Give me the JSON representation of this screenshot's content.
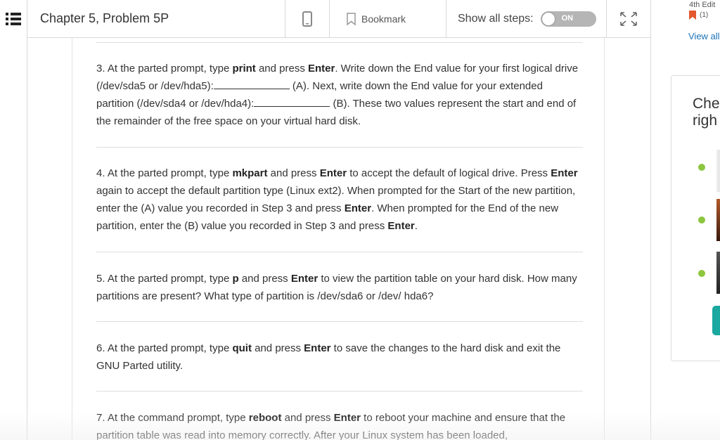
{
  "header": {
    "title": "Chapter 5, Problem 5P",
    "bookmark_label": "Bookmark",
    "show_steps_label": "Show all steps:",
    "toggle_label": "ON",
    "menu_icon": "menu-list-icon",
    "device_icon": "phone-icon",
    "expand_icon": "expand-arrows-icon"
  },
  "steps": [
    {
      "parts": [
        {
          "t": "3. At the parted prompt, type "
        },
        {
          "b": "print"
        },
        {
          "t": " and press "
        },
        {
          "b": "Enter"
        },
        {
          "t": ". Write down the End value for your first logical drive (/dev/sda5 or /dev/hda5):"
        },
        {
          "blank": 108
        },
        {
          "t": " (A). Next, write down the End value for your extended partition (/dev/sda4 or /dev/hda4):"
        },
        {
          "blank": 108
        },
        {
          "t": " (B). These two values represent the start and end of the remainder of the free space on your virtual hard disk."
        }
      ]
    },
    {
      "parts": [
        {
          "t": "4. At the parted prompt, type "
        },
        {
          "b": "mkpart"
        },
        {
          "t": " and press "
        },
        {
          "b": "Enter"
        },
        {
          "t": " to accept the default of logical drive. Press "
        },
        {
          "b": "Enter"
        },
        {
          "t": " again to accept the default partition type (Linux ext2). When prompted for the Start of the new partition, enter the (A) value you recorded in Step 3 and press "
        },
        {
          "b": "Enter"
        },
        {
          "t": ". When prompted for the End of the new partition, enter the (B) value you recorded in Step 3 and press "
        },
        {
          "b": "Enter"
        },
        {
          "t": "."
        }
      ]
    },
    {
      "parts": [
        {
          "t": "5. At the parted prompt, type "
        },
        {
          "b": "p"
        },
        {
          "t": " and press "
        },
        {
          "b": "Enter"
        },
        {
          "t": " to view the partition table on your hard disk. How many partitions are present? What type of partition is /dev/sda6 or /dev/ hda6?"
        }
      ]
    },
    {
      "parts": [
        {
          "t": "6. At the parted prompt, type "
        },
        {
          "b": "quit"
        },
        {
          "t": " and press "
        },
        {
          "b": "Enter"
        },
        {
          "t": " to save the changes to the hard disk and exit the GNU Parted utility."
        }
      ]
    },
    {
      "parts": [
        {
          "t": "7. At the command prompt, type "
        },
        {
          "b": "reboot"
        },
        {
          "t": " and press "
        },
        {
          "b": "Enter"
        },
        {
          "t": " to reboot your machine and ensure that the partition table was read into memory correctly. After your Linux system has been loaded,"
        }
      ]
    }
  ],
  "sidebar": {
    "edition": "4th Edit",
    "bookmark_count": "(1)",
    "view_all": "View all",
    "card_title": "Che righ",
    "accent_color": "#8cc63f",
    "teal_color": "#1aa8a0"
  }
}
